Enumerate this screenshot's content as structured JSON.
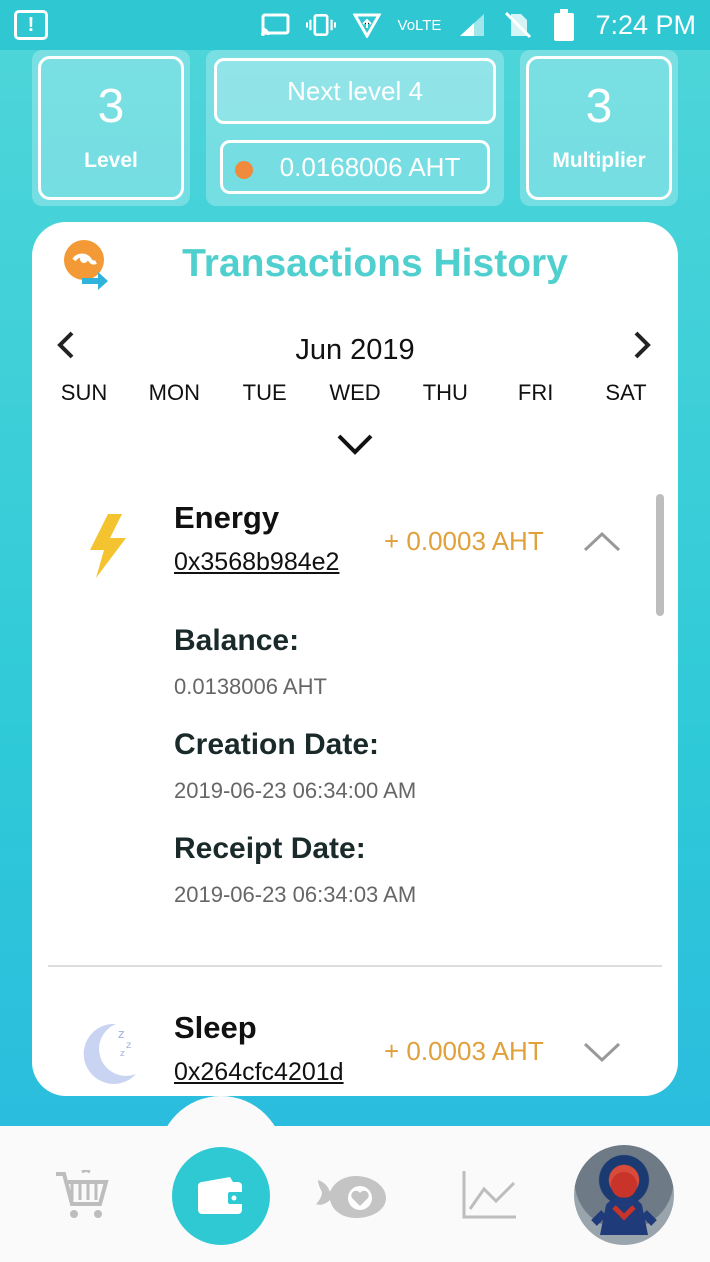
{
  "status_bar": {
    "network_label": "VoLTE",
    "time": "7:24 PM"
  },
  "level_card": {
    "value": "3",
    "label": "Level"
  },
  "next_level": {
    "label": "Next level 4",
    "balance": "0.0168006 AHT"
  },
  "multiplier_card": {
    "value": "3",
    "label": "Multiplier"
  },
  "history": {
    "title": "Transactions History",
    "month": "Jun 2019",
    "days": [
      "SUN",
      "MON",
      "TUE",
      "WED",
      "THU",
      "FRI",
      "SAT"
    ]
  },
  "transactions": [
    {
      "name": "Energy",
      "hash": "0x3568b984e2",
      "amount": "+ 0.0003 AHT",
      "expanded": true,
      "balance_label": "Balance:",
      "balance": "0.0138006 AHT",
      "creation_label": "Creation Date:",
      "creation_date": "2019-06-23 06:34:00 AM",
      "receipt_label": "Receipt Date:",
      "receipt_date": "2019-06-23 06:34:03 AM"
    },
    {
      "name": "Sleep",
      "hash": "0x264cfc4201d",
      "amount": "+ 0.0003 AHT",
      "expanded": false
    }
  ],
  "bottom_nav": {
    "items": [
      "shop",
      "wallet",
      "whale-heart",
      "chart",
      "profile"
    ],
    "active": "wallet"
  },
  "colors": {
    "accent": "#2ec9d3",
    "title": "#4fd0cf",
    "amount": "#e0a03a"
  }
}
